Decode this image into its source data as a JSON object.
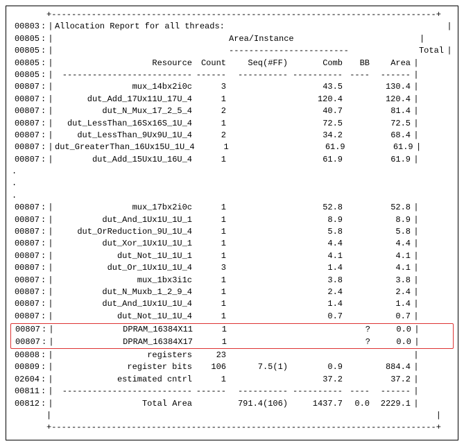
{
  "title": "Allocation Report for all threads:",
  "section_header": "Area/Instance",
  "headers": {
    "resource": "Resource",
    "count": "Count",
    "seq": "Seq(#FF)",
    "comb": "Comb",
    "bb": "BB",
    "total_area": "Total",
    "area": "Area"
  },
  "top_border": "+-----------------------------------------------------------------------------+",
  "title_line_no": "00803",
  "hdr_line_nos": [
    "00805",
    "00805",
    "00805",
    "00805"
  ],
  "hdr_dash_sub": "------------------------",
  "hdr_dash_row": {
    "res": "--------------------------",
    "count": "------",
    "seq": "----------",
    "comb": "----------",
    "bb": "----",
    "area": "------"
  },
  "rows1": [
    {
      "ln": "00807",
      "res": "mux_14bx2i0c",
      "count": "3",
      "seq": "",
      "comb": "43.5",
      "bb": "",
      "area": "130.4"
    },
    {
      "ln": "00807",
      "res": "dut_Add_17Ux11U_17U_4",
      "count": "1",
      "seq": "",
      "comb": "120.4",
      "bb": "",
      "area": "120.4"
    },
    {
      "ln": "00807",
      "res": "dut_N_Mux_17_2_5_4",
      "count": "2",
      "seq": "",
      "comb": "40.7",
      "bb": "",
      "area": "81.4"
    },
    {
      "ln": "00807",
      "res": "dut_LessThan_16Sx16S_1U_4",
      "count": "1",
      "seq": "",
      "comb": "72.5",
      "bb": "",
      "area": "72.5"
    },
    {
      "ln": "00807",
      "res": "dut_LessThan_9Ux9U_1U_4",
      "count": "2",
      "seq": "",
      "comb": "34.2",
      "bb": "",
      "area": "68.4"
    },
    {
      "ln": "00807",
      "res": "dut_GreaterThan_16Ux15U_1U_4",
      "count": "1",
      "seq": "",
      "comb": "61.9",
      "bb": "",
      "area": "61.9"
    },
    {
      "ln": "00807",
      "res": "dut_Add_15Ux1U_16U_4",
      "count": "1",
      "seq": "",
      "comb": "61.9",
      "bb": "",
      "area": "61.9"
    }
  ],
  "rows2": [
    {
      "ln": "00807",
      "res": "mux_17bx2i0c",
      "count": "1",
      "seq": "",
      "comb": "52.8",
      "bb": "",
      "area": "52.8"
    },
    {
      "ln": "00807",
      "res": "dut_And_1Ux1U_1U_1",
      "count": "1",
      "seq": "",
      "comb": "8.9",
      "bb": "",
      "area": "8.9"
    },
    {
      "ln": "00807",
      "res": "dut_OrReduction_9U_1U_4",
      "count": "1",
      "seq": "",
      "comb": "5.8",
      "bb": "",
      "area": "5.8"
    },
    {
      "ln": "00807",
      "res": "dut_Xor_1Ux1U_1U_1",
      "count": "1",
      "seq": "",
      "comb": "4.4",
      "bb": "",
      "area": "4.4"
    },
    {
      "ln": "00807",
      "res": "dut_Not_1U_1U_1",
      "count": "1",
      "seq": "",
      "comb": "4.1",
      "bb": "",
      "area": "4.1"
    },
    {
      "ln": "00807",
      "res": "dut_Or_1Ux1U_1U_4",
      "count": "3",
      "seq": "",
      "comb": "1.4",
      "bb": "",
      "area": "4.1"
    },
    {
      "ln": "00807",
      "res": "mux_1bx3i1c",
      "count": "1",
      "seq": "",
      "comb": "3.8",
      "bb": "",
      "area": "3.8"
    },
    {
      "ln": "00807",
      "res": "dut_N_Muxb_1_2_9_4",
      "count": "1",
      "seq": "",
      "comb": "2.4",
      "bb": "",
      "area": "2.4"
    },
    {
      "ln": "00807",
      "res": "dut_And_1Ux1U_1U_4",
      "count": "1",
      "seq": "",
      "comb": "1.4",
      "bb": "",
      "area": "1.4"
    },
    {
      "ln": "00807",
      "res": "dut_Not_1U_1U_4",
      "count": "1",
      "seq": "",
      "comb": "0.7",
      "bb": "",
      "area": "0.7"
    }
  ],
  "rows_highlight": [
    {
      "ln": "00807",
      "res": "DPRAM_16384X11",
      "count": "1",
      "seq": "",
      "comb": "",
      "bb": "?",
      "area": "0.0"
    },
    {
      "ln": "00807",
      "res": "DPRAM_16384X17",
      "count": "1",
      "seq": "",
      "comb": "",
      "bb": "?",
      "area": "0.0"
    }
  ],
  "rows3": [
    {
      "ln": "00808",
      "res": "registers",
      "count": "23",
      "seq": "",
      "comb": "",
      "bb": "",
      "area": ""
    },
    {
      "ln": "00809",
      "res": "register bits",
      "count": "106",
      "seq": "7.5(1)",
      "comb": "0.9",
      "bb": "",
      "area": "884.4"
    },
    {
      "ln": "02604",
      "res": "estimated cntrl",
      "count": "1",
      "seq": "",
      "comb": "37.2",
      "bb": "",
      "area": "37.2"
    }
  ],
  "dash_line_no": "00811",
  "total_row": {
    "ln": "00812",
    "res": "Total Area",
    "count": "",
    "seq": "791.4(106)",
    "comb": "1437.7",
    "bb": "0.0",
    "area": "2229.1"
  },
  "blank_line_sep": "|                                                                             |",
  "skip": "."
}
